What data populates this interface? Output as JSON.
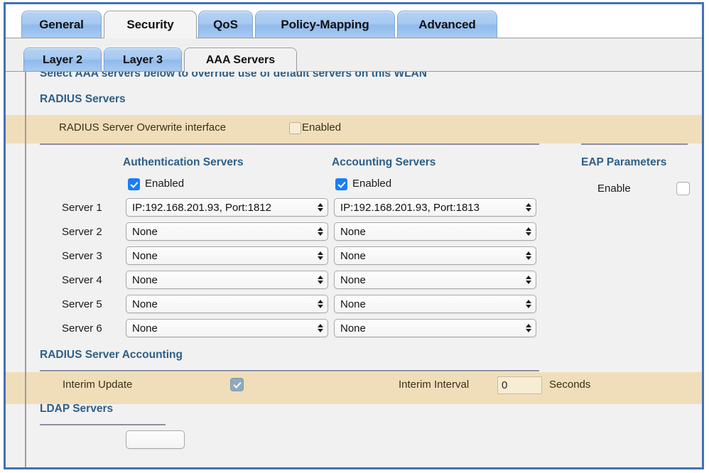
{
  "window": {
    "frame_color": "#4271b8"
  },
  "tabs_primary": [
    {
      "label": "General",
      "active": false
    },
    {
      "label": "Security",
      "active": true
    },
    {
      "label": "QoS",
      "active": false
    },
    {
      "label": "Policy-Mapping",
      "active": false
    },
    {
      "label": "Advanced",
      "active": false
    }
  ],
  "tabs_secondary": [
    {
      "label": "Layer 2",
      "active": false
    },
    {
      "label": "Layer 3",
      "active": false
    },
    {
      "label": "AAA Servers",
      "active": true
    }
  ],
  "form": {
    "intro": "Select AAA servers below to override use of default servers on this WLAN",
    "radius_servers_heading": "RADIUS Servers",
    "overwrite": {
      "label": "RADIUS Server Overwrite interface",
      "checkbox_label": "Enabled",
      "checked": false
    },
    "columns": {
      "authentication": "Authentication Servers",
      "accounting": "Accounting Servers",
      "eap": "EAP Parameters"
    },
    "enabled_label": "Enabled",
    "auth_enabled": true,
    "acct_enabled": true,
    "eap": {
      "label": "Enable",
      "checked": false
    },
    "server_rows": [
      {
        "label": "Server 1",
        "auth": "IP:192.168.201.93, Port:1812",
        "acct": "IP:192.168.201.93, Port:1813"
      },
      {
        "label": "Server 2",
        "auth": "None",
        "acct": "None"
      },
      {
        "label": "Server 3",
        "auth": "None",
        "acct": "None"
      },
      {
        "label": "Server 4",
        "auth": "None",
        "acct": "None"
      },
      {
        "label": "Server 5",
        "auth": "None",
        "acct": "None"
      },
      {
        "label": "Server 6",
        "auth": "None",
        "acct": "None"
      }
    ],
    "accounting_heading": "RADIUS Server Accounting",
    "interim_update": {
      "label": "Interim Update",
      "checked": true
    },
    "interim_interval": {
      "label": "Interim Interval",
      "value": "0",
      "units": "Seconds"
    },
    "ldap_heading": "LDAP Servers",
    "ldap_first_select": ""
  },
  "colors": {
    "accent_blue": "#2e5f88",
    "highlight_band": "#f0debb",
    "tab_blue": "#a7c9f1",
    "checkbox_on": "#1a7ef5"
  }
}
